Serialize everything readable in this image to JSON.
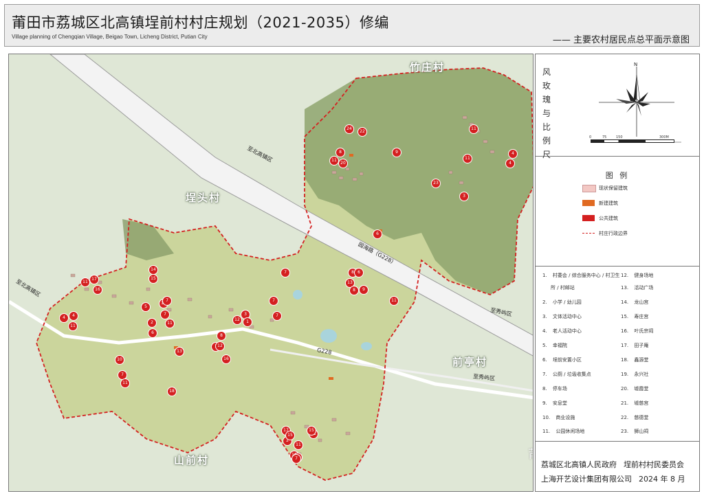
{
  "header": {
    "title": "莆田市荔城区北高镇埕前村村庄规划（2021-2035）修编",
    "subtitle_en": "Village planning of Chengqian Village, Beigao Town, Licheng District, Putian City",
    "map_subtitle": "—— 主要农村居民点总平面示意图"
  },
  "compass": {
    "label": "风玫瑰与比例尺",
    "north": "N",
    "scale_ticks": [
      "0",
      "75",
      "150",
      "300M"
    ]
  },
  "legend": {
    "title": "图 例",
    "items": [
      {
        "label": "现状保留建筑",
        "color": "#f3c8c4"
      },
      {
        "label": "新建建筑",
        "color": "#e06a22"
      },
      {
        "label": "公共建筑",
        "color": "#d42020"
      },
      {
        "label": "村庄行政边界",
        "color": "#d42020"
      }
    ]
  },
  "facility_list": [
    {
      "num": "1.",
      "label": "村委会 / 综合服务中心 / 村卫生"
    },
    {
      "num": "",
      "label": "所 / 村邮站"
    },
    {
      "num": "2.",
      "label": "小学 / 幼儿园"
    },
    {
      "num": "3.",
      "label": "文体活动中心"
    },
    {
      "num": "4.",
      "label": "老人活动中心"
    },
    {
      "num": "5.",
      "label": "幸福院"
    },
    {
      "num": "6.",
      "label": "埕前安置小区"
    },
    {
      "num": "7.",
      "label": "公厕 / 垃圾收集点"
    },
    {
      "num": "8.",
      "label": "停车场"
    },
    {
      "num": "9.",
      "label": "安息堂"
    },
    {
      "num": "10.",
      "label": "商业设施"
    },
    {
      "num": "11.",
      "label": "公园休闲场地"
    },
    {
      "num": "12.",
      "label": "健身场地"
    },
    {
      "num": "13.",
      "label": "活动广场"
    },
    {
      "num": "14.",
      "label": "龙山宫"
    },
    {
      "num": "15.",
      "label": "寿庄宫"
    },
    {
      "num": "16.",
      "label": "叶氏宗祠"
    },
    {
      "num": "17.",
      "label": "田子庵"
    },
    {
      "num": "18.",
      "label": "鑫源堂"
    },
    {
      "num": "19.",
      "label": "永兴社"
    },
    {
      "num": "20.",
      "label": "墟霞堂"
    },
    {
      "num": "21.",
      "label": "墟慈宫"
    },
    {
      "num": "22.",
      "label": "慈德堂"
    },
    {
      "num": "23.",
      "label": "狮山祠"
    }
  ],
  "footer": {
    "gov": "荔城区北高镇人民政府",
    "committee": "埕前村村民委员会",
    "designer": "上海开艺设计集团有限公司",
    "date": "2024 年 8 月"
  },
  "map": {
    "villages": {
      "zhuzhuang": "竹庄村",
      "chengtou": "埕头村",
      "qianting": "前亭村",
      "shanqian": "山前村"
    },
    "roads": {
      "to_beigao_1": "至北高镇区",
      "to_beigao_2": "至北高镇区",
      "to_xiuyu_1": "至秀屿区",
      "to_xiuyu_2": "至秀屿区",
      "yuanhai": "园海路（G228）",
      "g228": "G228"
    },
    "markers": [
      "24",
      "22",
      "8",
      "11",
      "20",
      "9",
      "11",
      "11",
      "4",
      "23",
      "3",
      "6",
      "8",
      "14",
      "15",
      "17",
      "11",
      "7",
      "7",
      "13",
      "16",
      "11",
      "5",
      "7",
      "4",
      "12",
      "3",
      "11",
      "2",
      "6",
      "9",
      "7",
      "11",
      "8",
      "11",
      "1",
      "7",
      "6",
      "4",
      "10",
      "8",
      "1",
      "16",
      "12",
      "21",
      "13",
      "10",
      "7",
      "11",
      "18",
      "17",
      "15",
      "11",
      "2",
      "7",
      "7",
      "15",
      "4"
    ],
    "colors": {
      "farmland": "#c8d69a",
      "mountain": "#8a9e6a",
      "highway": "#f4f4f4",
      "boundary": "#d42020",
      "water": "#a9d4dc"
    }
  },
  "watermark": "莆田网 0594.com"
}
